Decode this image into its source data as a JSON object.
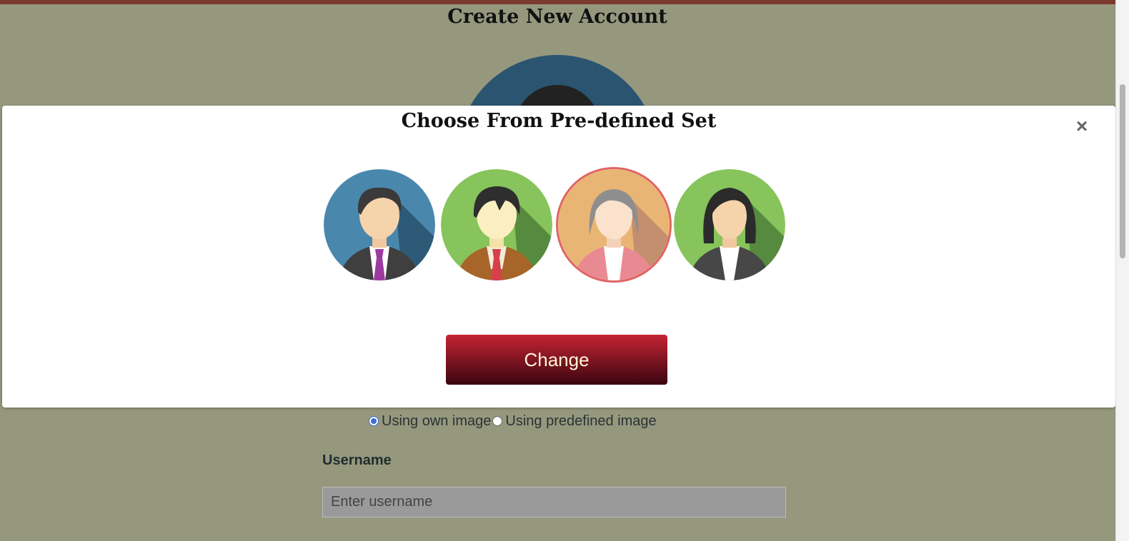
{
  "page": {
    "title": "Create New Account"
  },
  "modal": {
    "title": "Choose From Pre-defined Set",
    "close_symbol": "×",
    "avatars": [
      {
        "name": "male-avatar-blue",
        "selected": false
      },
      {
        "name": "young-male-avatar-green",
        "selected": false
      },
      {
        "name": "elderly-female-avatar-orange",
        "selected": true
      },
      {
        "name": "female-avatar-green",
        "selected": false
      }
    ],
    "change_label": "Change"
  },
  "form": {
    "image_source_options": [
      {
        "label": "Using own image",
        "checked": true
      },
      {
        "label": "Using predefined image",
        "checked": false
      }
    ],
    "username_label": "Username",
    "username_placeholder": "Enter username",
    "username_value": ""
  },
  "colors": {
    "page_background": "#96987e",
    "button_top": "#c52434",
    "button_bottom": "#3a0510",
    "selected_border": "#e06464"
  }
}
